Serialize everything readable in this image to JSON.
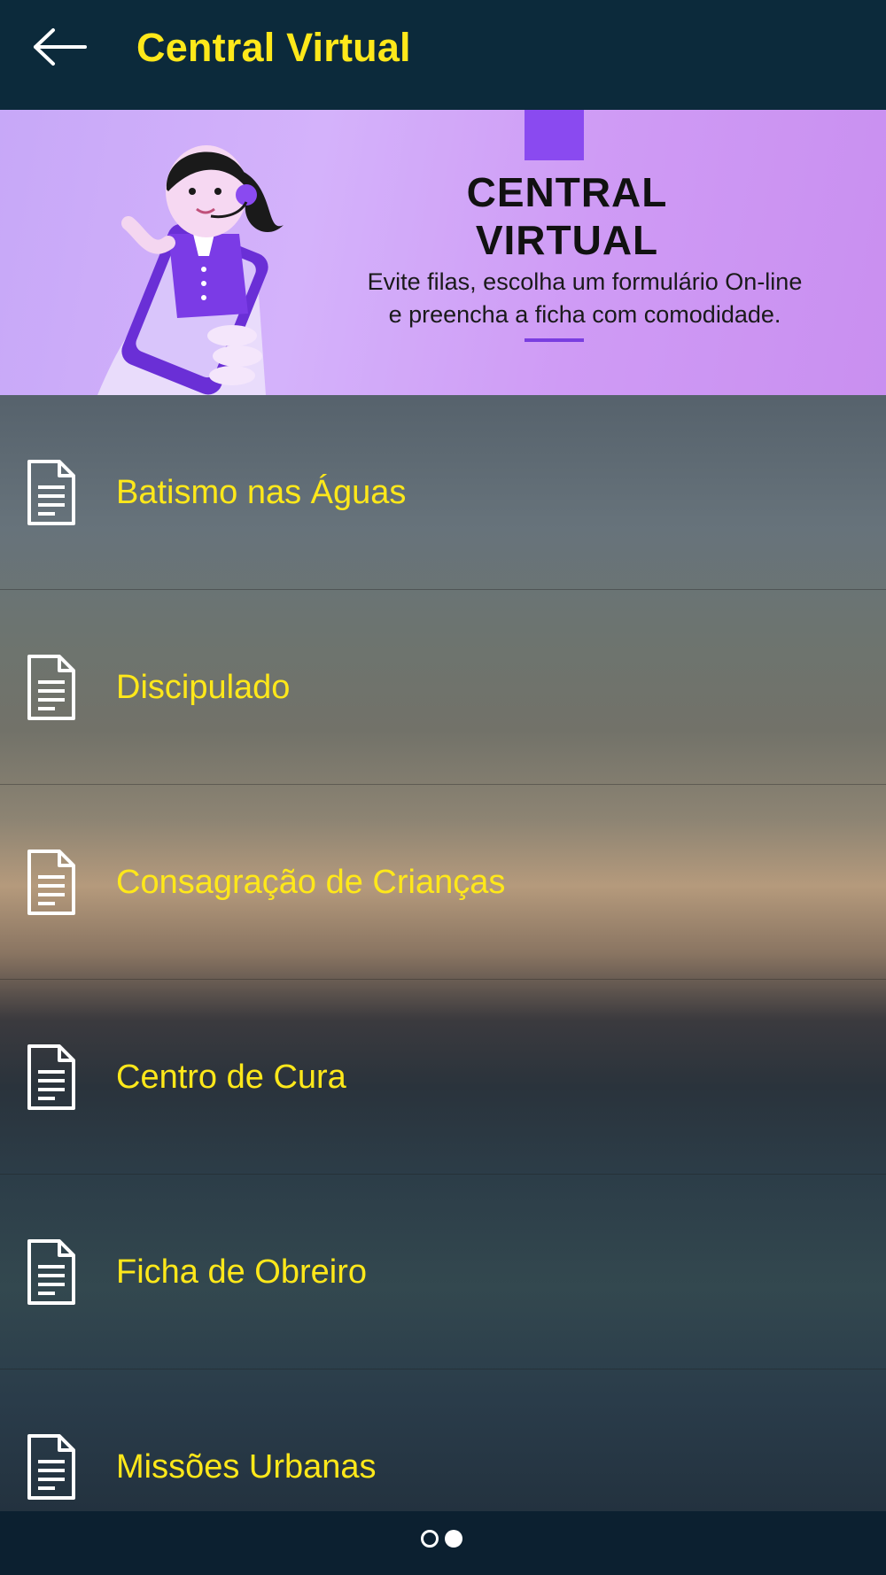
{
  "appbar": {
    "title": "Central Virtual",
    "back_icon": "arrow-left-icon"
  },
  "banner": {
    "title_line1": "CENTRAL",
    "title_line2": "VIRTUAL",
    "subtitle_line1": "Evite filas, escolha um formulário On-line",
    "subtitle_line2": "e preencha a ficha com comodidade.",
    "accent_color": "#8a4af0",
    "illustration": "call-center-woman-with-phone"
  },
  "menu": {
    "icon": "document-icon",
    "label_color": "#ffe81a",
    "items": [
      {
        "label": "Batismo nas Águas"
      },
      {
        "label": "Discipulado"
      },
      {
        "label": "Consagração de Crianças"
      },
      {
        "label": "Centro de Cura"
      },
      {
        "label": "Ficha de Obreiro"
      },
      {
        "label": "Missões Urbanas"
      }
    ]
  },
  "pager": {
    "page_count": 2,
    "active_page": 2
  }
}
